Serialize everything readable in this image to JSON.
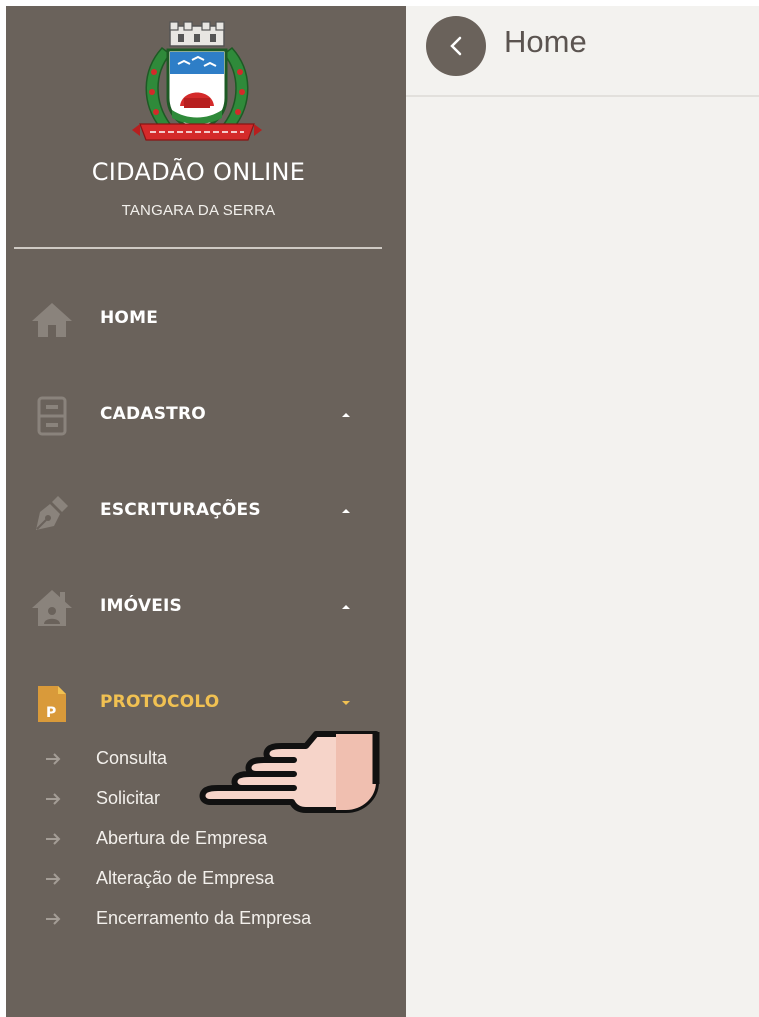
{
  "brand": {
    "title": "CIDADÃO ONLINE",
    "subtitle": "TANGARA DA SERRA"
  },
  "header": {
    "title": "Home"
  },
  "menu": [
    {
      "label": "HOME",
      "icon": "home-icon",
      "has_caret": false,
      "active": false
    },
    {
      "label": "CADASTRO",
      "icon": "file-cabinet-icon",
      "has_caret": true,
      "active": false
    },
    {
      "label": "ESCRITURAÇÕES",
      "icon": "pen-nib-icon",
      "has_caret": true,
      "active": false
    },
    {
      "label": "IMÓVEIS",
      "icon": "house-user-icon",
      "has_caret": true,
      "active": false
    },
    {
      "label": "PROTOCOLO",
      "icon": "protocol-document-icon",
      "has_caret": true,
      "active": true
    }
  ],
  "protocol_icon_letter": "P",
  "submenu": [
    {
      "label": "Consulta"
    },
    {
      "label": "Solicitar"
    },
    {
      "label": "Abertura de Empresa"
    },
    {
      "label": "Alteração de Empresa"
    },
    {
      "label": "Encerramento da Empresa"
    }
  ],
  "colors": {
    "sidebar_bg": "#6a625b",
    "main_bg": "#f3f2ef",
    "accent_active": "#f1c152",
    "icon_gray": "#8a837c"
  }
}
